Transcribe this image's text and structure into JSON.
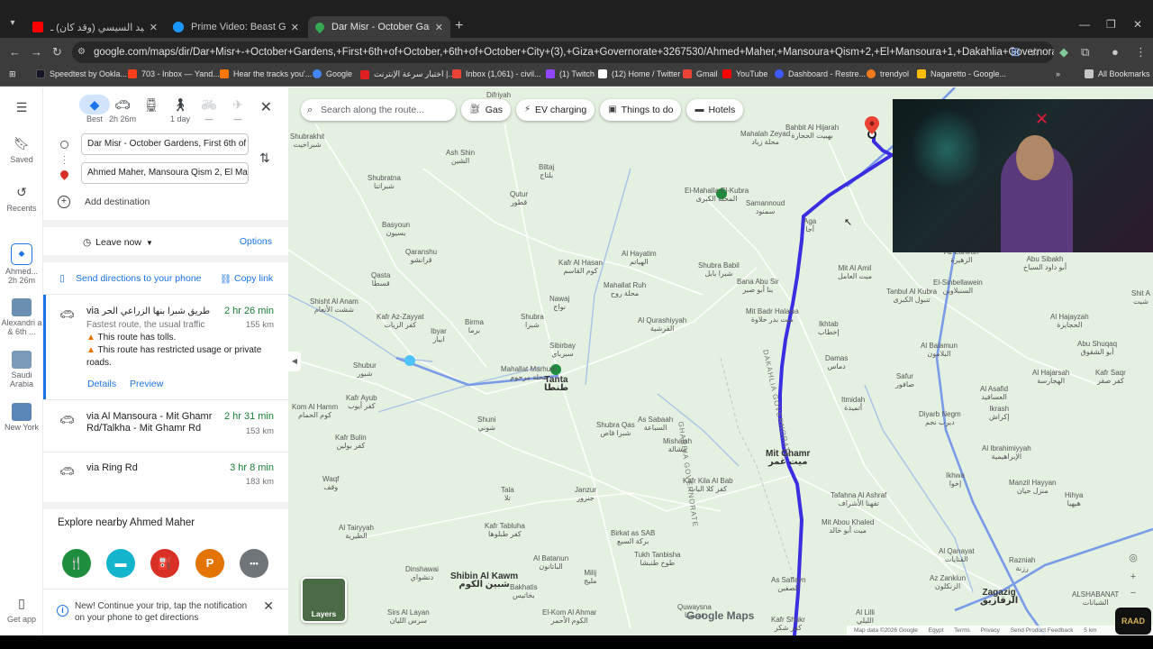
{
  "browser": {
    "tabs": [
      {
        "title": "اللواء وليد السيسي (وقد كان) ـ be",
        "color": "#ff0000"
      },
      {
        "title": "Prime Video: Beast Games - Sea",
        "color": "#1a98ff"
      },
      {
        "title": "Dar Misr - October Gardens to",
        "color": "#34a853"
      }
    ],
    "new_tab": "+",
    "url": "google.com/maps/dir/Dar+Misr+-+October+Gardens,+First+6th+of+October,+6th+of+October+City+(3),+Giza+Governorate+3267530/Ahmed+Maher,+Mansoura+Qism+2,+El+Mansoura+1,+Dakahlia+Governorate/@30.809778,31.0234795,...",
    "bookmarks": [
      {
        "label": "Speedtest by Ookla...",
        "color": "#141526"
      },
      {
        "label": "703 - Inbox — Yand...",
        "color": "#fc3f1d"
      },
      {
        "label": "Hear the tracks you'...",
        "color": "#ff7700"
      },
      {
        "label": "Google",
        "color": "#4285f4"
      },
      {
        "label": "اختبار سرعة الإنترنت |...",
        "color": "#e02020"
      },
      {
        "label": "Inbox (1,061) - civil...",
        "color": "#ea4335"
      },
      {
        "label": "(1) Twitch",
        "color": "#9146ff"
      },
      {
        "label": "(12) Home / Twitter",
        "color": "#ffffff"
      },
      {
        "label": "Gmail",
        "color": "#ea4335"
      },
      {
        "label": "YouTube",
        "color": "#ff0000"
      },
      {
        "label": "Dashboard - Restre...",
        "color": "#3d5afe"
      },
      {
        "label": "trendyol",
        "color": "#f27a1a"
      },
      {
        "label": "Nagaretto - Google...",
        "color": "#fbbc04"
      }
    ],
    "all_bookmarks": "All Bookmarks"
  },
  "rail": {
    "saved": "Saved",
    "recents": "Recents",
    "recent_directions": {
      "title": "Ahmed...",
      "duration": "2h 26m"
    },
    "places": [
      {
        "label": "Alexandri a & 6th ...",
        "color": "#6b8fb0"
      },
      {
        "label": "Saudi Arabia",
        "color": "#7a9ab8"
      },
      {
        "label": "New York",
        "color": "#5b86b8"
      }
    ],
    "get_app": "Get app"
  },
  "panel": {
    "modes": [
      {
        "icon": "best-icon",
        "label": "Best",
        "selected": true
      },
      {
        "icon": "car-icon",
        "label": "2h 26m"
      },
      {
        "icon": "transit-icon",
        "label": ""
      },
      {
        "icon": "walk-icon",
        "label": "1 day"
      },
      {
        "icon": "bike-icon",
        "label": "—"
      },
      {
        "icon": "flight-icon",
        "label": "—"
      }
    ],
    "origin": "Dar Misr - October Gardens, First 6th of",
    "destination": "Ahmed Maher, Mansoura Qism 2, El Man",
    "add_destination": "Add destination",
    "leave_now": "Leave now",
    "options": "Options",
    "send_directions": "Send directions to your phone",
    "copy_link": "Copy link",
    "routes": [
      {
        "via": "via",
        "via_name": "طريق شبرا بنها الزراعي الحر",
        "time": "2 hr 26 min",
        "distance": "155 km",
        "subtitle": "Fastest route, the usual traffic",
        "warnings": [
          "This route has tolls.",
          "This route has restricted usage or private roads."
        ],
        "details": "Details",
        "preview": "Preview"
      },
      {
        "name": "via Al Mansoura - Mit Ghamr Rd/Talkha - Mit Ghamr Rd",
        "time": "2 hr 31 min",
        "distance": "153 km"
      },
      {
        "name": "via Ring Rd",
        "time": "3 hr 8 min",
        "distance": "183 km"
      }
    ],
    "explore_title": "Explore nearby Ahmed Maher",
    "categories": [
      {
        "icon": "restaurant-icon",
        "glyph": "🍴",
        "color": "#1e8e3e"
      },
      {
        "icon": "hotel-icon",
        "glyph": "▬",
        "color": "#12b5cb"
      },
      {
        "icon": "gas-icon",
        "glyph": "⛽",
        "color": "#d93025"
      },
      {
        "icon": "parking-icon",
        "glyph": "P",
        "color": "#e37400"
      },
      {
        "icon": "more-icon",
        "glyph": "•••",
        "color": "#70757a"
      }
    ],
    "notification": "New! Continue your trip, tap the notification on your phone to get directions"
  },
  "map": {
    "search_placeholder": "Search along the route...",
    "chips": [
      {
        "icon": "gas-icon",
        "label": "Gas"
      },
      {
        "icon": "ev-icon",
        "label": "EV charging"
      },
      {
        "icon": "camera-icon",
        "label": "Things to do"
      },
      {
        "icon": "bed-icon",
        "label": "Hotels"
      }
    ],
    "places": [
      {
        "name": "Difriyah\nدفرية",
        "big": false
      },
      {
        "name": "Shubrakhit\nشبراخيت",
        "big": false
      },
      {
        "name": "Ash Shin\nالشين",
        "big": false
      },
      {
        "name": "Biltaj\nبلتاج",
        "big": false
      },
      {
        "name": "Qutur\nقطور",
        "big": false
      },
      {
        "name": "Shubratna\nشبراتنا",
        "big": false
      },
      {
        "name": "Basyoun\nبسيون",
        "big": false
      },
      {
        "name": "Qaranshu\nقرانشو",
        "big": false
      },
      {
        "name": "Qasta\nقسطا",
        "big": false
      },
      {
        "name": "Shisht Al Anam\nششت الأنعام",
        "big": false
      },
      {
        "name": "Kafr Az-Zayyat\nكفر الزيات",
        "big": false
      },
      {
        "name": "Ibyar\nابيار",
        "big": false
      },
      {
        "name": "Birma\nبرما",
        "big": false
      },
      {
        "name": "Shubra\nشبرا",
        "big": false
      },
      {
        "name": "Shubur\nشبور",
        "big": false
      },
      {
        "name": "Mahallat Marhum\nمحلة مرحوم",
        "big": false
      },
      {
        "name": "Tanta\nطنطا",
        "big": true
      },
      {
        "name": "Sibirbay\nسبرباي",
        "big": false
      },
      {
        "name": "Nawaj\nنواج",
        "big": false
      },
      {
        "name": "Kafr Al Hasan\nكوم القاسم",
        "big": false
      },
      {
        "name": "Al Hayatim\nالهياتم",
        "big": false
      },
      {
        "name": "El-Mahalla El-Kubra\nالمحلة الكبرى",
        "big": true
      },
      {
        "name": "Mahallat Ruh\nمحلة روح",
        "big": false
      },
      {
        "name": "Shubra Babil\nشبرا بابل",
        "big": false
      },
      {
        "name": "Al Qurashiyyah\nالقرشية",
        "big": false
      },
      {
        "name": "Mahalah Zeyad\nمحلة زياد",
        "big": false
      },
      {
        "name": "Bahbit Al Hijarah\nبهبيت الحجارة",
        "big": false
      },
      {
        "name": "Samannoud\nسمنود",
        "big": false
      },
      {
        "name": "Aga\nأجا",
        "big": false
      },
      {
        "name": "Bana Abu Sir\nبنا أبو صير",
        "big": false
      },
      {
        "name": "Mit Badr Halawa\nميت بدر حلاوة",
        "big": false
      },
      {
        "name": "Mit Al Amil\nميت العامل",
        "big": false
      },
      {
        "name": "Tanbul Al Kubra\nتنبول الكبرى",
        "big": false
      },
      {
        "name": "Ikhtab\nإخطاب",
        "big": false
      },
      {
        "name": "Damas\nدماس",
        "big": false
      },
      {
        "name": "Itmidah\nأتميدة",
        "big": false
      },
      {
        "name": "Mit Ghamr\nميت غمر",
        "big": true
      },
      {
        "name": "Safur\nصافور",
        "big": false
      },
      {
        "name": "Kafr Ayub\nكفر أيوب",
        "big": false
      },
      {
        "name": "Shuni\nشوني",
        "big": false
      },
      {
        "name": "Shubra Qas\nشبرا قاص",
        "big": false
      },
      {
        "name": "As Sabaah\nالسباعة",
        "big": false
      },
      {
        "name": "Mishalah\nمشالة",
        "big": false
      },
      {
        "name": "Kafr Kila Al Bab\nكفر كلا الباب",
        "big": false
      },
      {
        "name": "Kafr Bulin\nكفر بولين",
        "big": false
      },
      {
        "name": "Kom Al Hamm\nكوم الحمام",
        "big": false
      },
      {
        "name": "Waqf\nوقف",
        "big": false
      },
      {
        "name": "Tala\nتلا",
        "big": false
      },
      {
        "name": "Janzur\nجنزور",
        "big": false
      },
      {
        "name": "Kafr Tabluha\nكفر طبلوها",
        "big": false
      },
      {
        "name": "Birkat as SAB\nبركة السبع",
        "big": false
      },
      {
        "name": "Tukh Tanbisha\nطوخ طنبشا",
        "big": false
      },
      {
        "name": "Al Batanun\nالباتانون",
        "big": false
      },
      {
        "name": "Milij\nمليج",
        "big": false
      },
      {
        "name": "Shibin Al Kawm\nشبين الكوم",
        "big": true
      },
      {
        "name": "Bakhatis\nبخاتيس",
        "big": false
      },
      {
        "name": "Al Tairyyah\nالطيرية",
        "big": false
      },
      {
        "name": "Dinshawai\nدنشواي",
        "big": false
      },
      {
        "name": "Sirs Al Layan\nسرس الليان",
        "big": false
      },
      {
        "name": "El-Kom Al Ahmar\nالكوم الأحمر",
        "big": false
      },
      {
        "name": "Quwaysna\nقويسنا",
        "big": false
      },
      {
        "name": "As Saffayn\nالصفين",
        "big": false
      },
      {
        "name": "Kafr Shukr\nكفر شكر",
        "big": false
      },
      {
        "name": "Tafahna Al Ashraf\nتفهنا الأشراف",
        "big": false
      },
      {
        "name": "Mit Abou Khaled\nميت أبو خالد",
        "big": false
      },
      {
        "name": "Al Qanayat\nالقنايات",
        "big": false
      },
      {
        "name": "Az Zanklun\nالزنكلون",
        "big": false
      },
      {
        "name": "Zagazig\nالزقازيق",
        "big": true
      },
      {
        "name": "Al Lilli\nالليلي",
        "big": false
      },
      {
        "name": "Razniah\nرزنة",
        "big": false
      },
      {
        "name": "Manzil Hayyan\nمنزل حيان",
        "big": false
      },
      {
        "name": "Hihya\nهيهيا",
        "big": false
      },
      {
        "name": "Al Ibrahimiyyah\nالإبراهيمية",
        "big": false
      },
      {
        "name": "Diyarb Negm\nديرب نجم",
        "big": false
      },
      {
        "name": "Ikhwa\nإخوا",
        "big": false
      },
      {
        "name": "Kafr Saqr\nكفر صقر",
        "big": false
      },
      {
        "name": "Al Hajarsah\nالهجارسة",
        "big": false
      },
      {
        "name": "Al Asafid\nالعسافيد",
        "big": false
      },
      {
        "name": "Ikrash\nإكراش",
        "big": false
      },
      {
        "name": "Al Hajayzah\nالحجايزة",
        "big": false
      },
      {
        "name": "Abu Shuqaq\nأبو الشقوق",
        "big": false
      },
      {
        "name": "Al Balamun\nالبلامون",
        "big": false
      },
      {
        "name": "El-Sinbellawein\nالسنبلاوين",
        "big": false
      },
      {
        "name": "Abu Sibakh\nأبو داود السباخ",
        "big": false
      },
      {
        "name": "Shit A\nشيت",
        "big": false
      },
      {
        "name": "Az Zahirah\nالزهيرة",
        "big": false
      },
      {
        "name": "ALSHABANAT\nالشبانات",
        "big": false
      }
    ],
    "governorates": [
      "GHARBIA GOVERNORATE",
      "DAKAHLIA GOVERNORATE"
    ],
    "layers": "Layers",
    "google_logo": "Google Maps",
    "footer": [
      "Map data ©2026 Google",
      "Egypt",
      "Terms",
      "Privacy",
      "Send Product Feedback",
      "5 km"
    ],
    "watermark": "RAAD"
  }
}
